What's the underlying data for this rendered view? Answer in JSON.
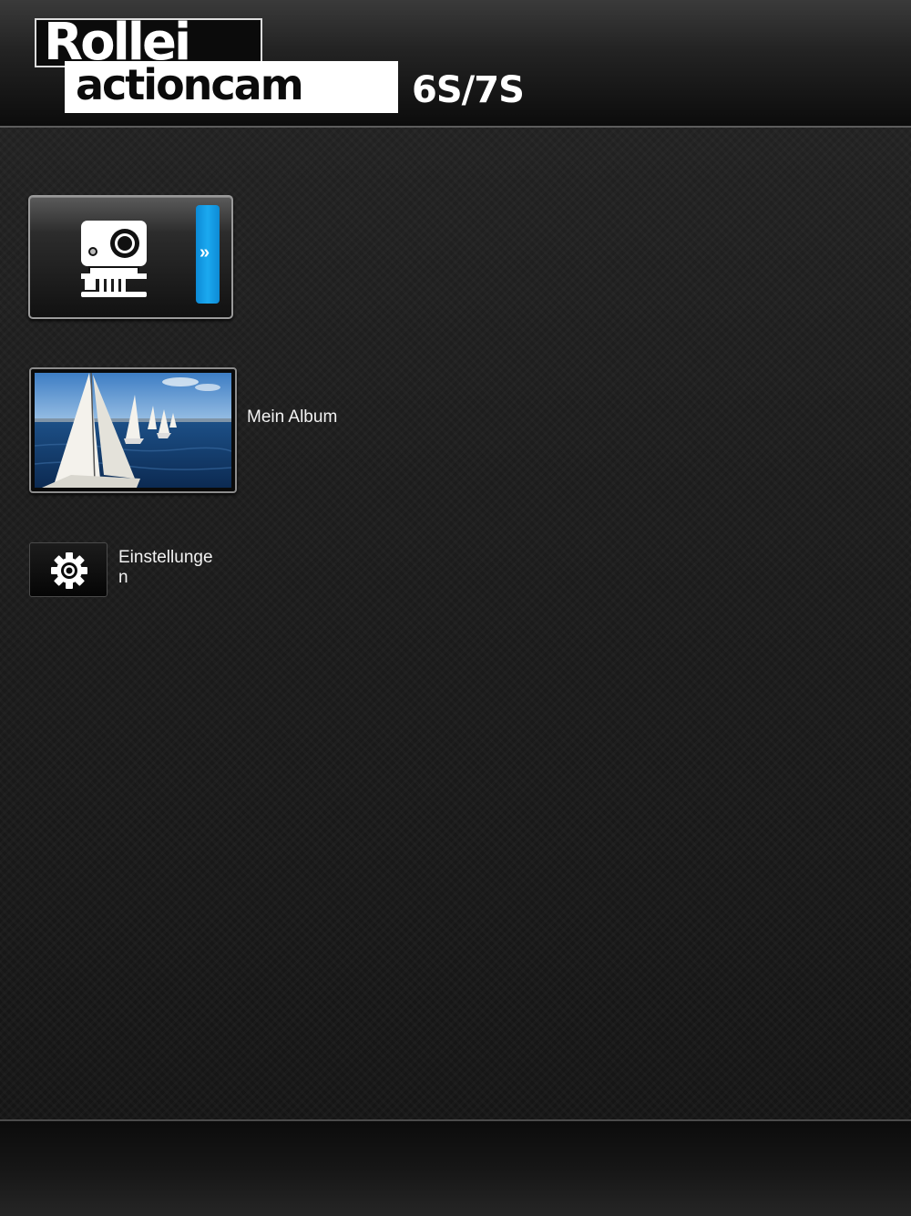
{
  "header": {
    "brand": "Rollei",
    "product": "actioncam",
    "model": "6S/7S"
  },
  "menu": {
    "camera": {
      "icon": "action-camera-icon",
      "arrow_icon": "double-chevron-right-icon",
      "arrow_glyph": "»",
      "accent_color": "#1ba9f0"
    },
    "album": {
      "label": "Mein Album",
      "thumbnail": "sailboats-photo"
    },
    "settings": {
      "label": "Einstellungen",
      "icon": "gear-icon"
    }
  }
}
